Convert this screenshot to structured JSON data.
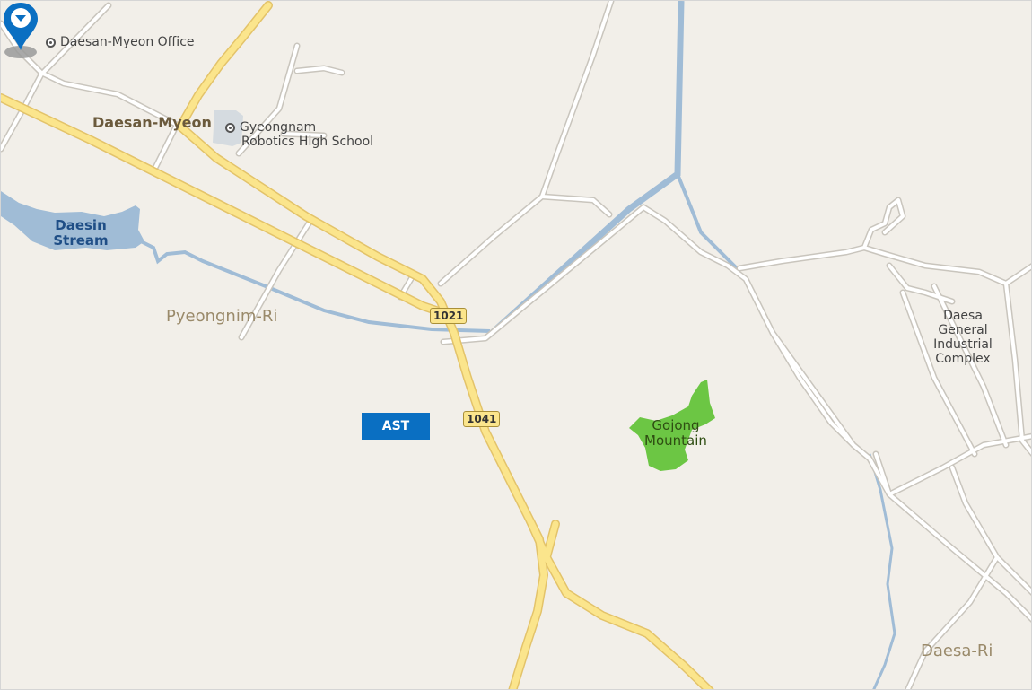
{
  "map": {
    "colors": {
      "background": "#f2efe9",
      "major_road": "#fbe58c",
      "major_road_casing": "#e3c36a",
      "minor_road": "#ffffff",
      "minor_road_casing": "#c9c5bd",
      "water": "#a0bcd6",
      "forest": "#6cc644",
      "facility": "#d5dbe0",
      "marker": "#0a6fc2"
    },
    "labels": {
      "office": "Daesan-Myeon Office",
      "myeon": "Daesan-Myeon",
      "school_line1": "Gyeongnam",
      "school_line2": "Robotics High School",
      "stream_line1": "Daesin",
      "stream_line2": "Stream",
      "pyeongnim": "Pyeongnim-Ri",
      "complex_line1": "Daesa",
      "complex_line2": "General",
      "complex_line3": "Industrial",
      "complex_line4": "Complex",
      "mountain_line1": "Gojong",
      "mountain_line2": "Mountain",
      "daesari": "Daesa-Ri"
    },
    "route_shields": [
      "1021",
      "1041"
    ],
    "marker": {
      "label": "AST",
      "icon": "map-pin-icon"
    },
    "poi_icon": "poi-circle-icon"
  }
}
